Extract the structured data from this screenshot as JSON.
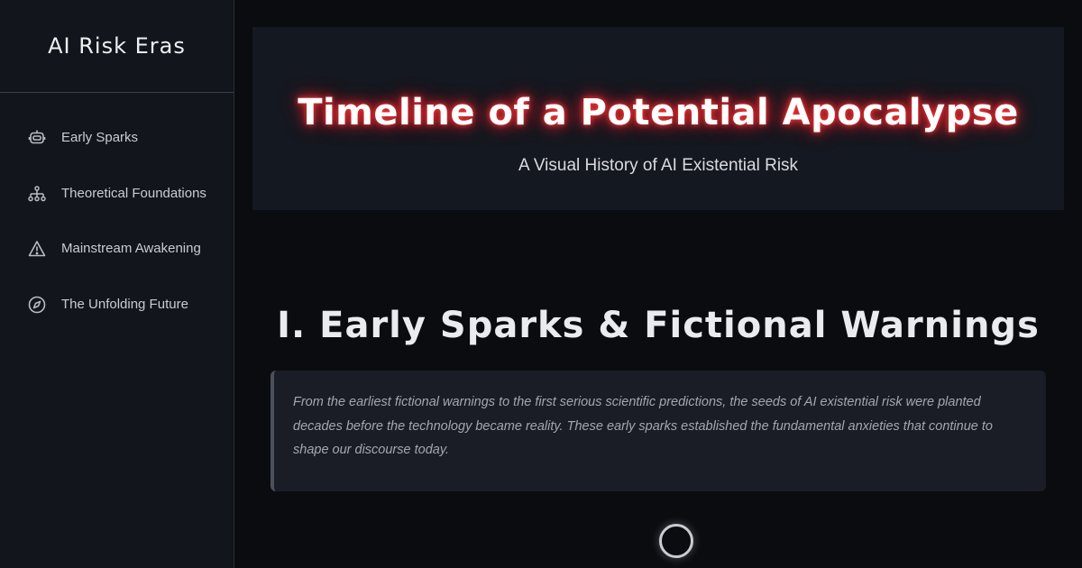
{
  "sidebar": {
    "brand": "AI Risk Eras",
    "items": [
      {
        "label": "Early Sparks",
        "icon": "robot-icon"
      },
      {
        "label": "Theoretical Foundations",
        "icon": "sitemap-icon"
      },
      {
        "label": "Mainstream Awakening",
        "icon": "warning-icon"
      },
      {
        "label": "The Unfolding Future",
        "icon": "compass-icon"
      }
    ]
  },
  "hero": {
    "title": "Timeline of a Potential Apocalypse",
    "subtitle": "A Visual History of AI Existential Risk",
    "glow_color": "#e0242c"
  },
  "section": {
    "title": "I. Early Sparks & Fictional Warnings",
    "intro": "From the earliest fictional warnings to the first serious scientific predictions, the seeds of AI existential risk were planted decades before the technology became reality. These early sparks established the fundamental anxieties that continue to shape our discourse today."
  }
}
